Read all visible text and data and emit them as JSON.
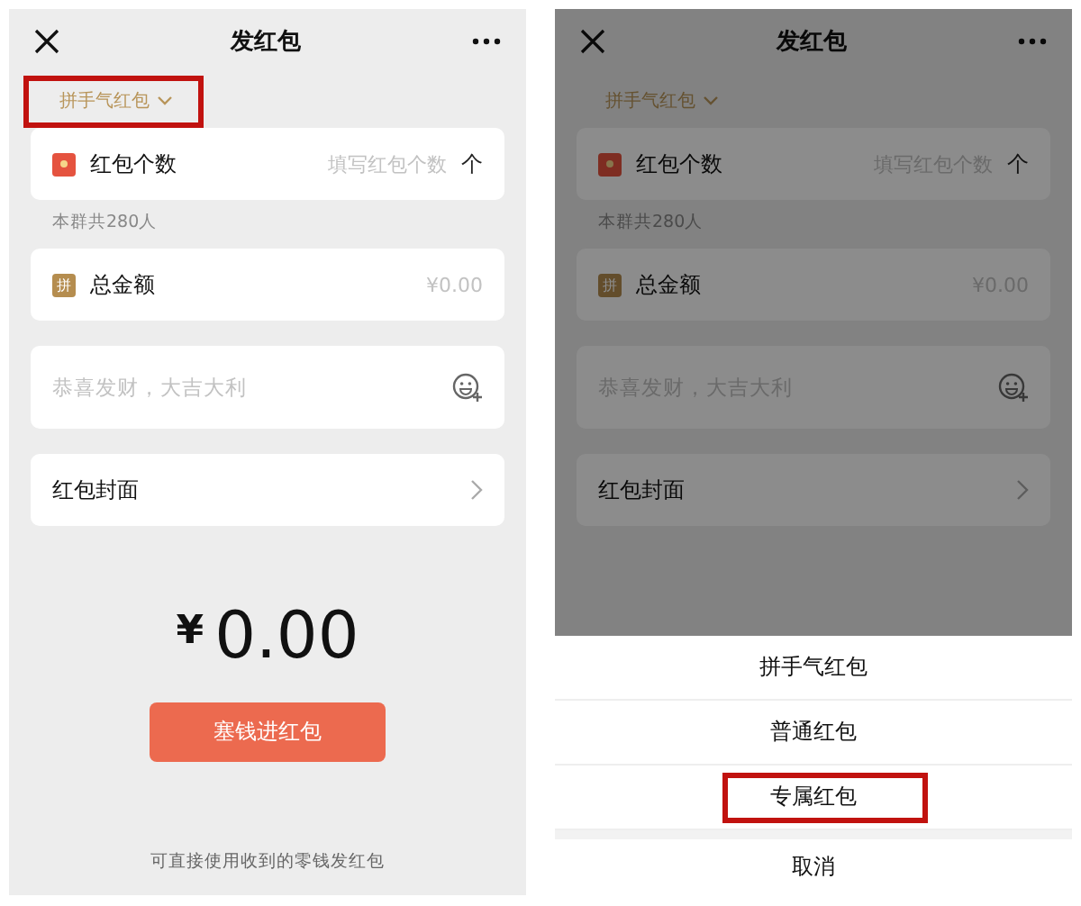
{
  "screens": [
    {
      "dimmed": false,
      "title": "发红包",
      "type_selector": {
        "label": "拼手气红包",
        "highlighted": true
      },
      "count_row": {
        "label": "红包个数",
        "placeholder": "填写红包个数",
        "unit": "个"
      },
      "group_note": "本群共280人",
      "amount_row": {
        "badge": "拼",
        "label": "总金额",
        "placeholder": "¥0.00"
      },
      "greeting": {
        "placeholder": "恭喜发财，大吉大利"
      },
      "cover_row": {
        "label": "红包封面"
      },
      "total": {
        "currency": "¥",
        "value": "0.00"
      },
      "submit_button": "塞钱进红包",
      "footer_note": "可直接使用收到的零钱发红包"
    },
    {
      "dimmed": true,
      "title": "发红包",
      "type_selector": {
        "label": "拼手气红包",
        "highlighted": false
      },
      "count_row": {
        "label": "红包个数",
        "placeholder": "填写红包个数",
        "unit": "个"
      },
      "group_note": "本群共280人",
      "amount_row": {
        "badge": "拼",
        "label": "总金额",
        "placeholder": "¥0.00"
      },
      "greeting": {
        "placeholder": "恭喜发财，大吉大利"
      },
      "cover_row": {
        "label": "红包封面"
      },
      "sheet": {
        "options": [
          {
            "label": "拼手气红包",
            "highlighted": false
          },
          {
            "label": "普通红包",
            "highlighted": false
          },
          {
            "label": "专属红包",
            "highlighted": true
          }
        ],
        "cancel": "取消"
      }
    }
  ]
}
